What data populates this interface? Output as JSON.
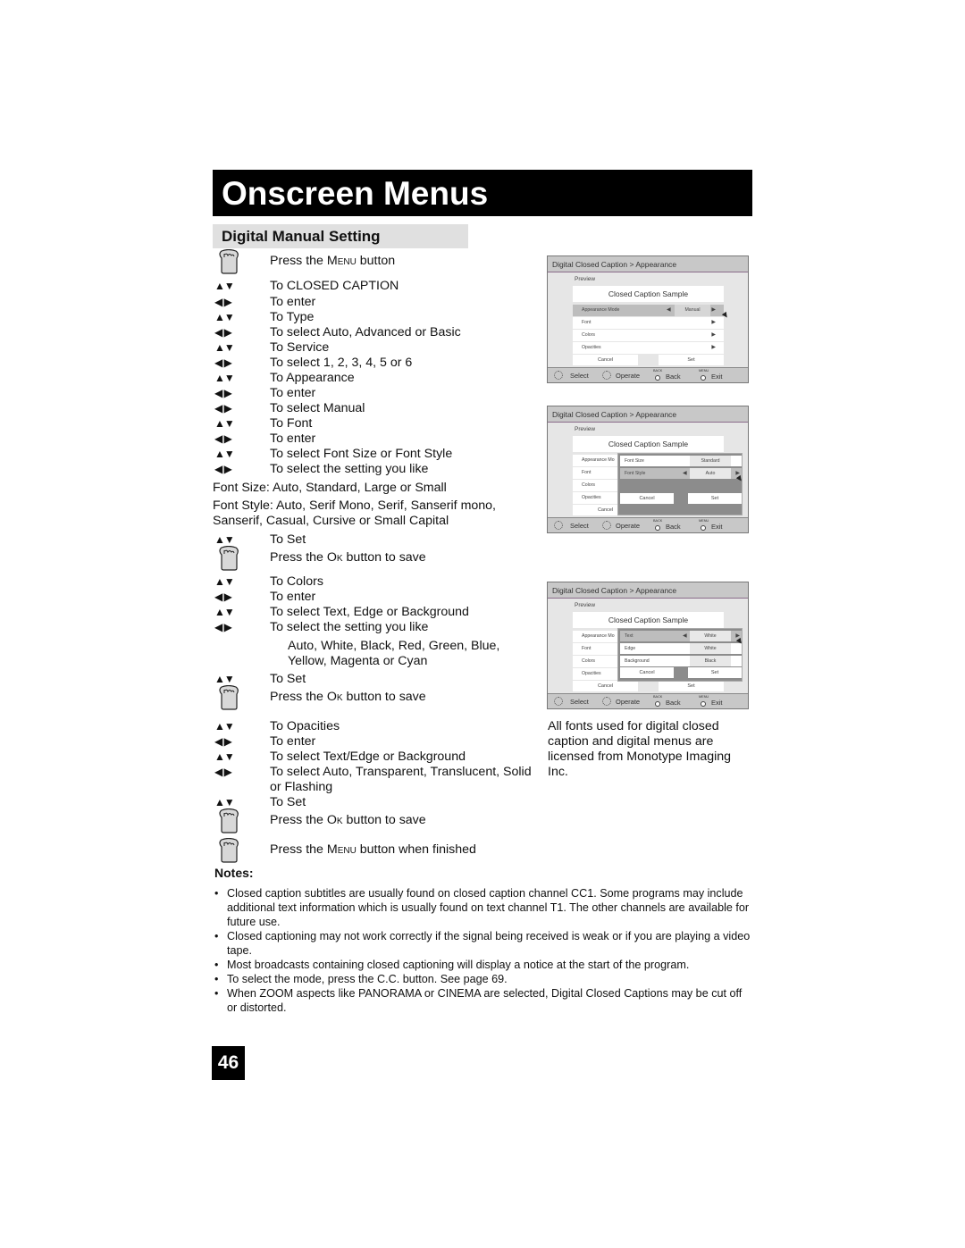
{
  "header": {
    "title": "Onscreen Menus",
    "section": "Digital Manual Setting"
  },
  "icons": {
    "press": "hand-press-icon",
    "updown": "▲▼",
    "leftright": "◀ ▶"
  },
  "steps": [
    {
      "icon": "press",
      "pre": "Press the ",
      "sc": "Menu",
      "post": " button"
    },
    {
      "icon": "updown",
      "text": "To CLOSED CAPTION"
    },
    {
      "icon": "leftright",
      "text": "To enter"
    },
    {
      "icon": "updown",
      "text": "To Type"
    },
    {
      "icon": "leftright",
      "text": "To select Auto, Advanced or Basic"
    },
    {
      "icon": "updown",
      "text": "To Service"
    },
    {
      "icon": "leftright",
      "text": "To select 1, 2, 3, 4, 5 or 6"
    },
    {
      "icon": "updown",
      "text": "To Appearance"
    },
    {
      "icon": "leftright",
      "text": "To enter"
    },
    {
      "icon": "leftright",
      "text": "To select Manual"
    },
    {
      "icon": "updown",
      "text": "To Font"
    },
    {
      "icon": "leftright",
      "text": "To enter"
    },
    {
      "icon": "updown",
      "text": "To select Font Size or Font Style"
    },
    {
      "icon": "leftright",
      "text": "To select the setting you like"
    }
  ],
  "font_size_line": "Font Size: Auto, Standard, Large or Small",
  "font_style_line1": "Font Style: Auto, Serif Mono, Serif, Sanserif mono,",
  "font_style_line2": "Sanserif, Casual, Cursive or Small Capital",
  "steps2": [
    {
      "icon": "updown",
      "text": "To Set"
    },
    {
      "icon": "press",
      "pre": "Press the ",
      "sc": "Ok",
      "post": " button to save"
    },
    {
      "icon": "updown",
      "text": "To Colors"
    },
    {
      "icon": "leftright",
      "text": "To enter"
    },
    {
      "icon": "updown",
      "text": "To select Text, Edge or Background"
    },
    {
      "icon": "leftright",
      "text": "To select the setting you like"
    }
  ],
  "colors_line1": "Auto, White, Black, Red, Green, Blue,",
  "colors_line2": "Yellow, Magenta or Cyan",
  "steps3": [
    {
      "icon": "updown",
      "text": "To Set"
    },
    {
      "icon": "press",
      "pre": "Press the ",
      "sc": "Ok",
      "post": " button to save"
    },
    {
      "icon": "updown",
      "text": "To Opacities"
    },
    {
      "icon": "leftright",
      "text": "To enter"
    },
    {
      "icon": "updown",
      "text": "To select Text/Edge or Background"
    },
    {
      "icon": "leftright",
      "text": "To select Auto, Transparent, Translucent, Solid"
    },
    {
      "icon": "none",
      "text": "or Flashing"
    },
    {
      "icon": "updown",
      "text": "To Set"
    },
    {
      "icon": "press",
      "pre": "Press the ",
      "sc": "Ok",
      "post": " button to save"
    },
    {
      "icon": "press",
      "pre": "Press the ",
      "sc": "Menu",
      "post": " button when finished"
    }
  ],
  "notes": {
    "heading": "Notes:",
    "items": [
      "Closed caption subtitles are usually found on closed caption channel CC1. Some programs may include additional text information which is usually found on text channel T1. The other channels are available for future use.",
      "Closed captioning may not work correctly if the signal being received is weak or if you are playing a video tape.",
      "Most broadcasts containing closed captioning will display a notice at the start of the program.",
      "To select the mode, press the C.C. button. See page 69.",
      "When ZOOM aspects like PANORAMA or CINEMA are selected, Digital Closed Captions may be cut off or distorted."
    ]
  },
  "side_note": "All fonts used for digital closed caption and digital menus are licensed from Monotype Imaging Inc.",
  "page_number": "46",
  "menu": {
    "breadcrumb": "Digital Closed Caption  >  Appearance",
    "preview_label": "Preview",
    "sample": "Closed Caption Sample",
    "rows": [
      "Appearance Mode",
      "Font",
      "Colors",
      "Opacities"
    ],
    "rows_short": [
      "Appearance Mo",
      "Font",
      "Colors",
      "Opacities"
    ],
    "mode_value": "Manual",
    "cancel": "Cancel",
    "set": "Set",
    "footer": {
      "select": "Select",
      "operate": "Operate",
      "back_small": "BACK",
      "back": "Back",
      "menu_small": "MENU",
      "exit": "Exit"
    },
    "font_sub": {
      "rows": [
        {
          "label": "Font Size",
          "value": "Standard"
        },
        {
          "label": "Font Style",
          "value": "Auto"
        }
      ]
    },
    "colors_sub": {
      "rows": [
        {
          "label": "Text",
          "value": "White"
        },
        {
          "label": "Edge",
          "value": "White"
        },
        {
          "label": "Background",
          "value": "Black"
        }
      ]
    },
    "arrow_right": "▶",
    "arrow_left": "◀"
  }
}
